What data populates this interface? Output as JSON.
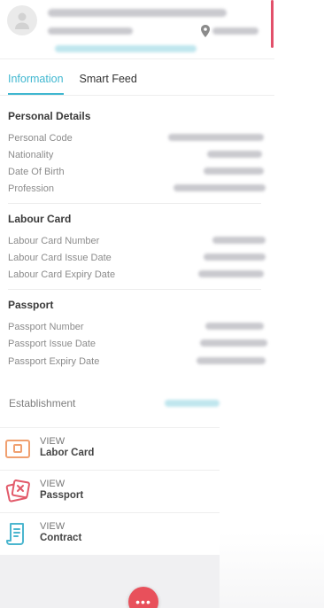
{
  "tabs": {
    "information": "Information",
    "smart_feed": "Smart Feed"
  },
  "personal": {
    "title": "Personal Details",
    "rows": [
      "Personal Code",
      "Nationality",
      "Date Of Birth",
      "Profession"
    ]
  },
  "labour": {
    "title": "Labour Card",
    "rows": [
      "Labour Card Number",
      "Labour Card Issue Date",
      "Labour Card Expiry Date"
    ]
  },
  "passport": {
    "title": "Passport",
    "rows": [
      "Passport Number",
      "Passport Issue Date",
      "Passport Expiry Date"
    ]
  },
  "establishment": {
    "label": "Establishment"
  },
  "actions": [
    {
      "top": "VIEW",
      "bottom": "Labor Card",
      "icon": "labor-card-icon",
      "color": "#f0a070"
    },
    {
      "top": "VIEW",
      "bottom": "Passport",
      "icon": "passport-icon",
      "color": "#e25a6a"
    },
    {
      "top": "VIEW",
      "bottom": "Contract",
      "icon": "contract-icon",
      "color": "#4bb6cf"
    }
  ],
  "fab": {
    "label": "•••",
    "color": "#e8505b"
  },
  "colors": {
    "accent": "#3fb7d0",
    "header_accent": "#e2506a"
  }
}
